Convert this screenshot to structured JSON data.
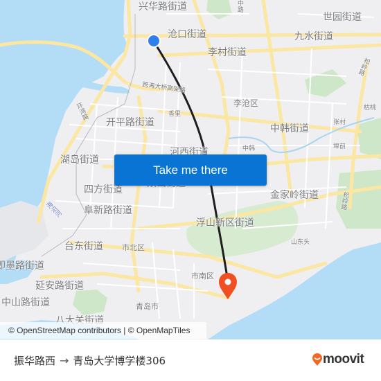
{
  "map": {
    "district_labels": [
      {
        "text": "兴华路街道"
      },
      {
        "text": "沧口街道"
      },
      {
        "text": "世园街道"
      },
      {
        "text": "九水街道"
      },
      {
        "text": "李村街道"
      },
      {
        "text": "开平路街道"
      },
      {
        "text": "中韩街道"
      },
      {
        "text": "河西街道"
      },
      {
        "text": "湖岛街道"
      },
      {
        "text": "四方街道"
      },
      {
        "text": "阜新路街道"
      },
      {
        "text": "金家岭街道"
      },
      {
        "text": "浮山新区街道"
      },
      {
        "text": "台东街道"
      },
      {
        "text": "即墨路街道"
      },
      {
        "text": "延安路街道"
      },
      {
        "text": "中山路街道"
      },
      {
        "text": "八大关街道"
      },
      {
        "text": "双山街道"
      }
    ],
    "place_labels": [
      {
        "text": "李沧区"
      },
      {
        "text": "香里"
      },
      {
        "text": "中韩"
      },
      {
        "text": "张村"
      },
      {
        "text": "埠前"
      },
      {
        "text": "枯桃"
      },
      {
        "text": "山东头"
      },
      {
        "text": "市北区"
      },
      {
        "text": "市南区"
      },
      {
        "text": "青岛市"
      }
    ],
    "road_labels": [
      {
        "text": "跨海大桥高架路"
      },
      {
        "text": "环湾路"
      },
      {
        "text": "松岭路"
      },
      {
        "text": "松岭路"
      },
      {
        "text": "中路"
      }
    ],
    "water_labels": [
      {
        "text": "海泊河"
      }
    ],
    "origin_marker": {
      "label": "振华路西",
      "color": "#2f80ed"
    },
    "destination_marker": {
      "label": "青岛大学博学楼306",
      "color": "#f04e23"
    },
    "route_color": "#1e1e1e"
  },
  "cta": {
    "label": "Take me there"
  },
  "attribution": {
    "text": "© OpenStreetMap contributors | © OpenMapTiles"
  },
  "footer": {
    "origin": "振华路西",
    "arrow": "→",
    "destination": "青岛大学博学楼306",
    "brand": "moovit",
    "brand_color": "#f26722"
  }
}
